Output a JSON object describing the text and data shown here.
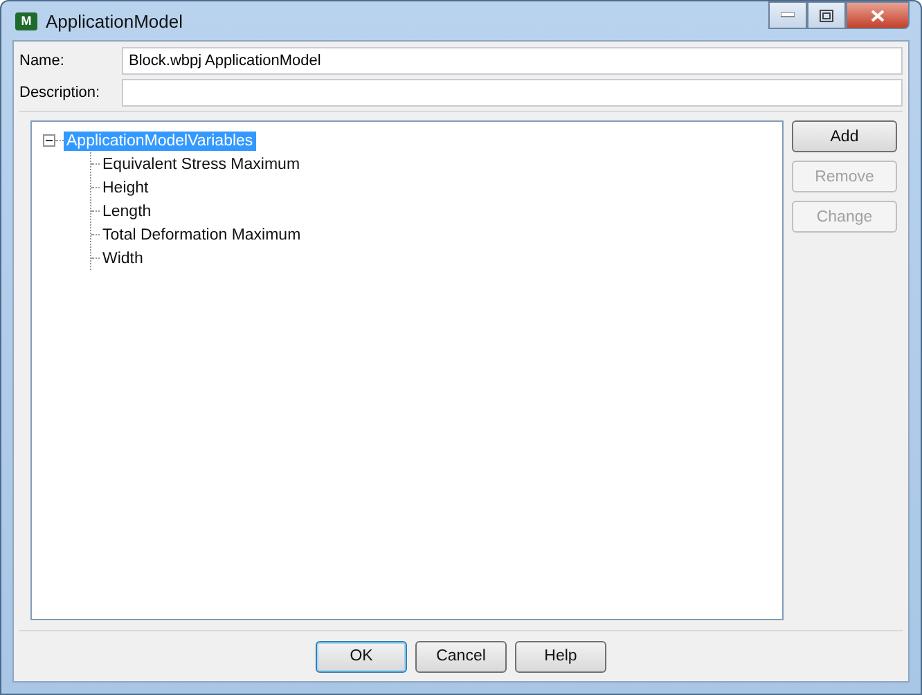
{
  "window": {
    "title": "ApplicationModel",
    "icon": "M"
  },
  "name_field": {
    "label": "Name:",
    "value": "Block.wbpj ApplicationModel"
  },
  "description_field": {
    "label": "Description:"
  },
  "tree": [
    {
      "label": "ApplicationModelVariables",
      "selected": true,
      "expanded": true,
      "children": [
        {
          "label": "Equivalent Stress Maximum",
          "selected": false
        },
        {
          "label": "Height",
          "selected": false
        },
        {
          "label": "Length",
          "selected": false
        },
        {
          "label": "Total Deformation Maximum",
          "selected": false
        },
        {
          "label": "Width",
          "selected": false
        }
      ]
    }
  ],
  "side_buttons": [
    {
      "label": "Add",
      "disabled": false
    },
    {
      "label": "Remove",
      "disabled": true
    },
    {
      "label": "Change",
      "disabled": true
    }
  ],
  "footer_buttons": [
    {
      "label": "OK",
      "default": true
    },
    {
      "label": "Cancel",
      "default": false
    },
    {
      "label": "Help",
      "default": false
    }
  ]
}
